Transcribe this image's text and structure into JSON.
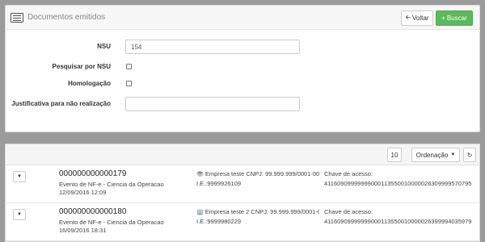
{
  "header": {
    "title": "Documentos emitidos",
    "back_label": "Voltar",
    "search_label": "Buscar"
  },
  "form": {
    "nsu_label": "NSU",
    "nsu_value": "154",
    "pesquisar_label": "Pesquisar por NSU",
    "homologacao_label": "Homologação",
    "justificativa_label": "Justificativa para não realização",
    "justificativa_value": ""
  },
  "toolbar": {
    "page_size": "10",
    "order_label": "Ordenação"
  },
  "rows": [
    {
      "nsu": "000000000000179",
      "event": "Evento de NF-e - Ciencia da Operacao",
      "date": "12/09/2016 12:09",
      "company": "Empresa teste CNPJ: 99.999.999/0001-00",
      "ie": "I.E.:9999926109",
      "key_label": "Chave de acesso:",
      "key": "41160909999999000113550010000026309999570795"
    },
    {
      "nsu": "000000000000180",
      "event": "Evento de NF-e - Ciencia da Operacao",
      "date": "16/09/2016 18:31",
      "company": "Empresa teste 2 CNPJ: 99.999.999/0001-07",
      "ie": "I.E.:9999980229",
      "key_label": "Chave de acesso:",
      "key": "41160909999999000113550010000026399994035979"
    }
  ]
}
